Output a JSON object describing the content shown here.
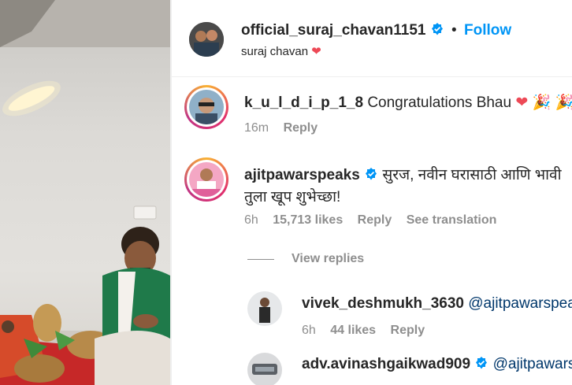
{
  "post_header": {
    "username": "official_suraj_chavan1151",
    "dot": "•",
    "follow_label": "Follow",
    "caption": "suraj chavan"
  },
  "comments": [
    {
      "username": "k_u_l_d_i_p_1_8",
      "text": "Congratulations Bhau",
      "time": "16m",
      "reply_label": "Reply"
    },
    {
      "username": "ajitpawarspeaks",
      "text_line1": "सुरज, नवीन घरासाठी आणि भावी",
      "text_line2": "तुला खूप शुभेच्छा!",
      "time": "6h",
      "likes": "15,713 likes",
      "reply_label": "Reply",
      "translate_label": "See translation",
      "view_replies_label": "View replies"
    }
  ],
  "replies": [
    {
      "username": "vivek_deshmukh_3630",
      "mention": "@ajitpawarspeaks",
      "time": "6h",
      "likes": "44 likes",
      "reply_label": "Reply"
    },
    {
      "username": "adv.avinashgaikwad909",
      "mention": "@ajitpawarspeaks"
    }
  ],
  "colors": {
    "verified": "#0095f6",
    "link": "#0095f6",
    "mention": "#00376b",
    "heart": "#ed4956",
    "muted": "#8e8e8e"
  }
}
